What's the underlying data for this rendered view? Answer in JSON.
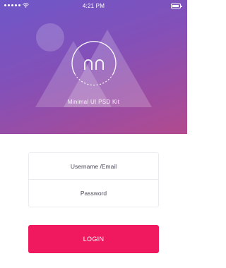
{
  "status_bar": {
    "time": "4:21 PM"
  },
  "brand": {
    "kit_label": "Minimal UI PSD Kit",
    "logo_icon": "nn-monogram-icon"
  },
  "form": {
    "username_placeholder": "Username /Email",
    "password_placeholder": "Password"
  },
  "actions": {
    "login_label": "LOGIN"
  },
  "colors": {
    "hero_gradient_start": "#6e57c9",
    "hero_gradient_end": "#b24a8e",
    "login_button": "#f0185f"
  }
}
